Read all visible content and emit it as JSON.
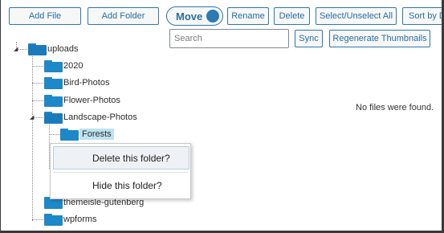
{
  "toolbar": {
    "add_file": "Add File",
    "add_folder": "Add Folder",
    "move_toggle": "Move",
    "rename": "Rename",
    "delete": "Delete",
    "select_unselect_all": "Select/Unselect All",
    "sort_by": "Sort by D"
  },
  "search": {
    "placeholder": "Search"
  },
  "sync": "Sync",
  "regenerate_thumbnails": "Regenerate Thumbnails",
  "tree": {
    "root": "uploads",
    "items": [
      "2020",
      "Bird-Photos",
      "Flower-Photos",
      "Landscape-Photos",
      "Forests",
      "themeisle-gutenberg",
      "wpforms"
    ]
  },
  "empty_message": "No files were found.",
  "context_menu": {
    "delete": "Delete this folder?",
    "hide": "Hide this folder?"
  },
  "colors": {
    "accent": "#2a6f9e",
    "folder": "#1e88c8",
    "selected": "#bfe2f2"
  }
}
